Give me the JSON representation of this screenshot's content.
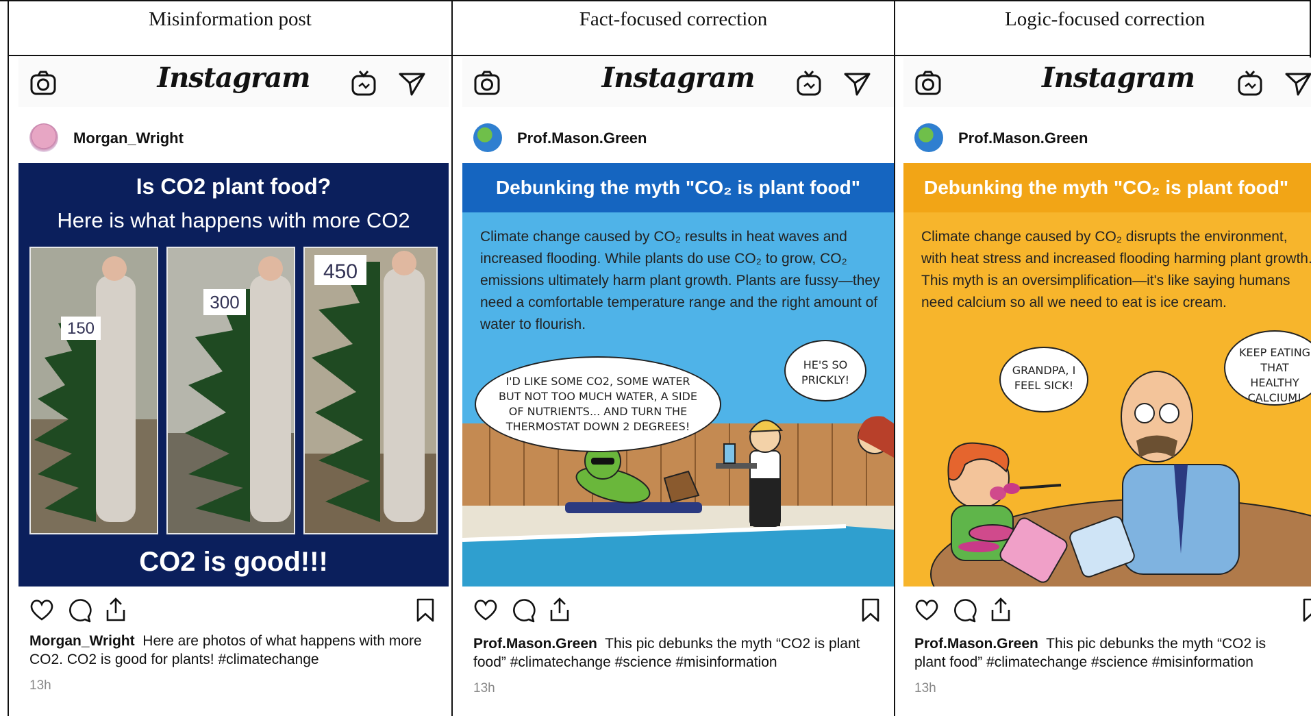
{
  "columns": [
    {
      "header": "Misinformation post",
      "app_title": "Instagram",
      "username": "Morgan_Wright",
      "post": {
        "title": "Is CO2 plant food?",
        "subtitle": "Here is what happens with more CO2",
        "photo_labels": [
          "150",
          "300",
          "450"
        ],
        "footer": "CO2 is good!!!"
      },
      "caption_user": "Morgan_Wright",
      "caption_text": "Here are photos of what happens with more CO2. CO2 is good for plants! #climatechange",
      "time": "13h"
    },
    {
      "header": "Fact-focused correction",
      "app_title": "Instagram",
      "username": "Prof.Mason.Green",
      "post": {
        "title": "Debunking the myth \"CO₂ is plant food\"",
        "body": "Climate change caused by CO₂ results in heat waves and increased flooding. While plants do use CO₂ to grow, CO₂ emissions ultimately harm plant growth. Plants are fussy—they need a comfortable temperature range and the right amount of water to flourish.",
        "bubble_left": "I'D LIKE SOME CO2, SOME WATER BUT NOT TOO MUCH WATER, A SIDE OF NUTRIENTS... AND TURN THE THERMOSTAT DOWN 2 DEGREES!",
        "bubble_right": "HE'S SO PRICKLY!"
      },
      "caption_user": "Prof.Mason.Green",
      "caption_text": "This pic debunks the myth “CO2 is plant food” #climatechange #science #misinformation",
      "time": "13h"
    },
    {
      "header": "Logic-focused correction",
      "app_title": "Instagram",
      "username": "Prof.Mason.Green",
      "post": {
        "title": "Debunking the myth \"CO₂ is plant food\"",
        "body": "Climate change caused by CO₂ disrupts the environment, with heat stress and increased flooding harming plant growth.  This myth is an oversimplification—it's like saying humans need calcium so all we need to eat is ice cream.",
        "bubble_left": "GRANDPA, I FEEL SICK!",
        "bubble_right": "KEEP EATING THAT HEALTHY CALCIUM!"
      },
      "caption_user": "Prof.Mason.Green",
      "caption_text": "This pic debunks the myth “CO2 is plant food” #climatechange #science #misinformation",
      "time": "13h"
    }
  ],
  "colors": {
    "post1_bg": "#0b1f5c",
    "post2_title": "#1565c0",
    "post2_bg": "#4fb3e8",
    "post3_title": "#f2a516",
    "post3_bg": "#f7b52c"
  },
  "icons": [
    "camera-icon",
    "igtv-icon",
    "direct-message-icon",
    "heart-icon",
    "comment-icon",
    "share-icon",
    "bookmark-icon"
  ]
}
